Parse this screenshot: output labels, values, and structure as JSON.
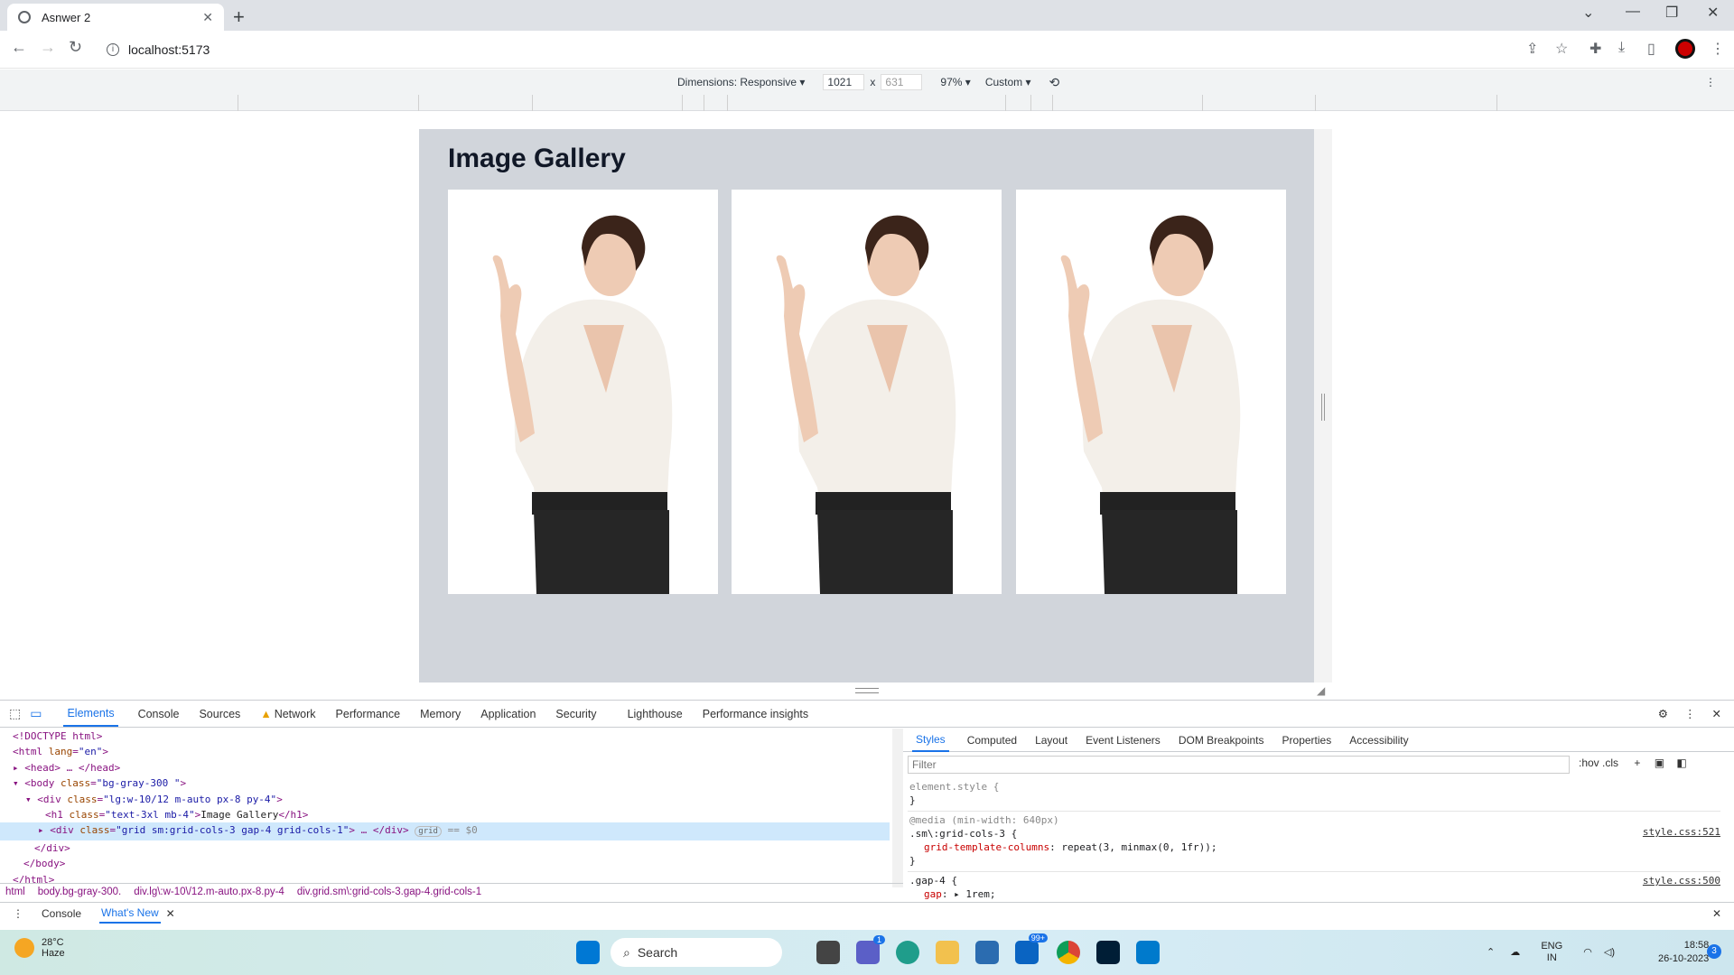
{
  "browser": {
    "tab_title": "Asnwer 2",
    "url": "localhost:5173"
  },
  "device_toolbar": {
    "dimensions_label": "Dimensions: Responsive",
    "width": "1021",
    "x_sep": "x",
    "height": "631",
    "zoom": "97%",
    "throttle": "Custom"
  },
  "page": {
    "title": "Image Gallery",
    "images": [
      {
        "icon": "woman-pointing-photo"
      },
      {
        "icon": "woman-pointing-photo"
      },
      {
        "icon": "woman-pointing-photo"
      }
    ],
    "background": "#d1d5db"
  },
  "devtools": {
    "tabs": [
      "Elements",
      "Console",
      "Sources",
      "Network",
      "Performance",
      "Memory",
      "Application",
      "Security",
      "Lighthouse",
      "Performance insights"
    ],
    "active_tab": "Elements",
    "dom": {
      "l1": "<!DOCTYPE html>",
      "l2_tag": "<html ",
      "l2_attr": "lang",
      "l2_val": "\"en\"",
      "l3": "<head>",
      "l3b": "</head>",
      "l4_tag": "<body ",
      "l4_attr": "class",
      "l4_val": "\"bg-gray-300 \"",
      "l5_tag": "<div ",
      "l5_attr": "class",
      "l5_val": "\"lg:w-10/12 m-auto px-8 py-4\"",
      "l6_tag": "<h1 ",
      "l6_attr": "class",
      "l6_val": "\"text-3xl mb-4\"",
      "l6_text": "Image Gallery",
      "l6_close": "</h1>",
      "l7_tag": "<div ",
      "l7_attr": "class",
      "l7_val": "\"grid sm:grid-cols-3 gap-4 grid-cols-1\"",
      "l7_close": "</div>",
      "l7_badge": "grid",
      "l7_eq": "== $0",
      "l8": "</div>",
      "l9": "</body>",
      "l10": "</html>"
    },
    "styles_tabs": [
      "Styles",
      "Computed",
      "Layout",
      "Event Listeners",
      "DOM Breakpoints",
      "Properties",
      "Accessibility"
    ],
    "filter_placeholder": "Filter",
    "styles_tools": ":hov  .cls",
    "rules": {
      "r1_sel": "element.style {",
      "r1_close": "}",
      "r2_media": "@media (min-width: 640px)",
      "r2_sel": ".sm\\:grid-cols-3 {",
      "r2_prop": "grid-template-columns",
      "r2_val": ": repeat(3, minmax(0, 1fr));",
      "r2_close": "}",
      "r2_src": "style.css:521",
      "r3_sel": ".gap-4 {",
      "r3_prop": "gap",
      "r3_val": ": ▸ 1rem;",
      "r3_src": "style.css:500"
    },
    "breadcrumbs": [
      "html",
      "body.bg-gray-300.",
      "div.lg\\:w-10\\/12.m-auto.px-8.py-4",
      "div.grid.sm\\:grid-cols-3.gap-4.grid-cols-1"
    ],
    "drawer_tabs": [
      "Console",
      "What's New"
    ]
  },
  "taskbar": {
    "temp": "28°C",
    "weather": "Haze",
    "search": "Search",
    "badge_teams": "1",
    "badge_mail": "99+",
    "lang1": "ENG",
    "lang2": "IN",
    "time": "18:58",
    "date": "26-10-2023",
    "notif": "3"
  }
}
